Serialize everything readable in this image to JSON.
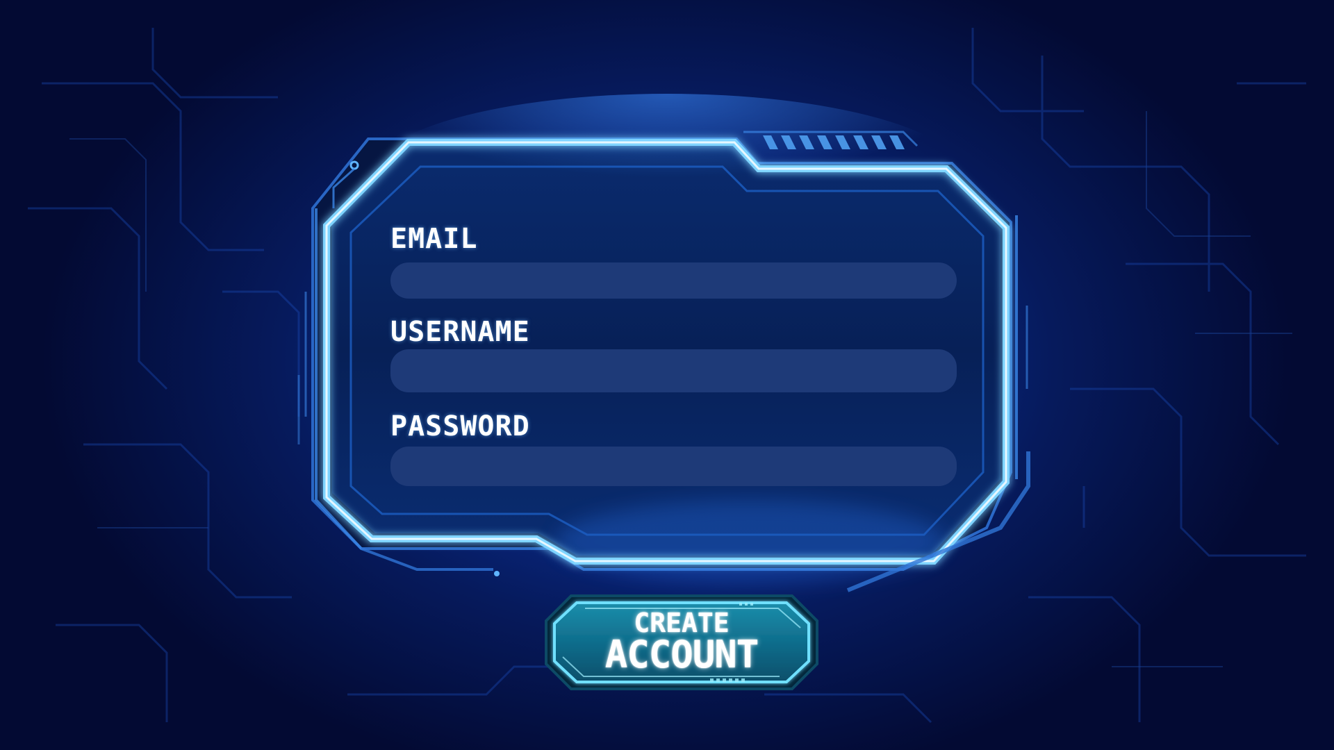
{
  "form": {
    "email_label": "EMAIL",
    "email_value": "",
    "username_label": "USERNAME",
    "username_value": "",
    "password_label": "PASSWORD",
    "password_value": ""
  },
  "actions": {
    "create_line1": "CREATE",
    "create_line2": "ACCOUNT"
  },
  "colors": {
    "background": "#061a5c",
    "frame_glow": "#4fc3ff",
    "panel_fill": "#0b2660",
    "field_fill": "#1e3a78",
    "button_fill": "#0f6d8c",
    "button_border": "#6fe0ff"
  }
}
